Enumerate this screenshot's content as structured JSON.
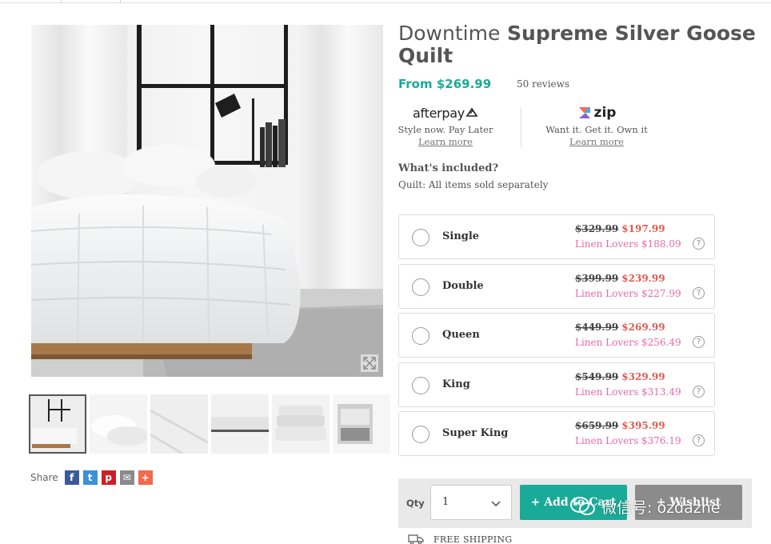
{
  "product": {
    "title_brand": "Downtime",
    "title_name": "Supreme Silver Goose Quilt",
    "price_from": "From $269.99",
    "reviews": "50 reviews"
  },
  "payment": {
    "afterpay": {
      "logo_text": "afterpay",
      "tagline": "Style now. Pay Later",
      "link": "Learn more"
    },
    "zip": {
      "logo_text": "zip",
      "tagline": "Want it. Get it. Own it",
      "link": "Learn more"
    }
  },
  "included": {
    "heading": "What's included?",
    "text": "Quilt: All items sold separately"
  },
  "sizes": [
    {
      "label": "Single",
      "was": "$329.99",
      "now": "$197.99",
      "member_label": "Linen Lovers",
      "member_price": "$188.09"
    },
    {
      "label": "Double",
      "was": "$399.99",
      "now": "$239.99",
      "member_label": "Linen Lovers",
      "member_price": "$227.99"
    },
    {
      "label": "Queen",
      "was": "$449.99",
      "now": "$269.99",
      "member_label": "Linen Lovers",
      "member_price": "$256.49"
    },
    {
      "label": "King",
      "was": "$549.99",
      "now": "$329.99",
      "member_label": "Linen Lovers",
      "member_price": "$313.49"
    },
    {
      "label": "Super King",
      "was": "$659.99",
      "now": "$395.99",
      "member_label": "Linen Lovers",
      "member_price": "$376.19"
    }
  ],
  "help_symbol": "?",
  "cart": {
    "qty_label": "Qty",
    "qty_value": "1",
    "add_label": "+ Add to Cart",
    "wishlist_label": "+ Wishlist"
  },
  "shipping": {
    "label": "FREE SHIPPING"
  },
  "share": {
    "label": "Share",
    "buttons": [
      {
        "name": "facebook",
        "glyph": "f",
        "color": "#3b5998"
      },
      {
        "name": "twitter",
        "glyph": "t",
        "color": "#3d8fd6"
      },
      {
        "name": "pinterest",
        "glyph": "p",
        "color": "#cb2027"
      },
      {
        "name": "email",
        "glyph": "✉",
        "color": "#8a8a8a"
      },
      {
        "name": "more",
        "glyph": "+",
        "color": "#f06a4c"
      }
    ]
  },
  "watermark": {
    "text": "微信号: ozdazhe"
  },
  "colors": {
    "accent": "#1aaa98",
    "sale_price": "#e05a4e",
    "member_price": "#e96aa6",
    "wishlist_button": "#8b8b8b"
  },
  "icons": [
    "expand-icon",
    "chevron-down-icon",
    "question-icon",
    "truck-icon",
    "wechat-icon"
  ]
}
